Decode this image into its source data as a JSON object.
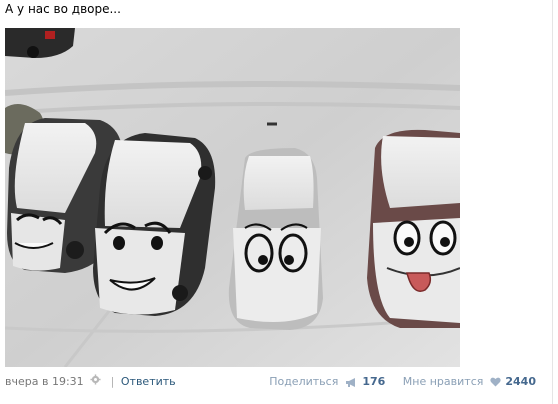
{
  "post": {
    "text": "А у нас во дворе...",
    "image": {
      "alt_subject": "snow-covered-cars-with-drawn-faces"
    }
  },
  "footer": {
    "timestamp": "вчера в 19:31",
    "separator": "|",
    "reply_label": "Ответить",
    "share_label": "Поделиться",
    "share_count": "176",
    "like_label": "Мне нравится",
    "like_count": "2440"
  },
  "colors": {
    "link": "#2b587a",
    "count": "#45688e",
    "muted": "#777777"
  },
  "icons": {
    "gear": "gear-icon",
    "share": "megaphone-icon",
    "like": "heart-icon"
  }
}
